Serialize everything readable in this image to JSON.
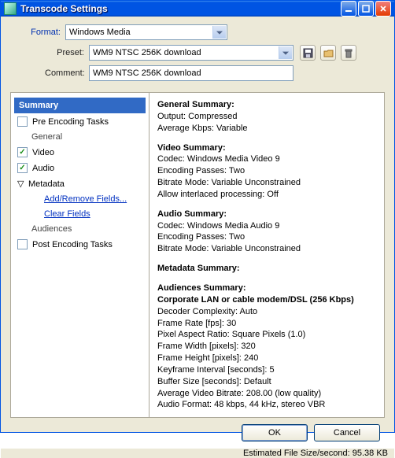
{
  "title": "Transcode Settings",
  "form": {
    "format_label": "Format:",
    "format_value": "Windows Media",
    "preset_label": "Preset:",
    "preset_value": "WM9 NTSC 256K download",
    "comment_label": "Comment:",
    "comment_value": "WM9 NTSC 256K download"
  },
  "tree": {
    "summary": "Summary",
    "pre": "Pre Encoding Tasks",
    "general": "General",
    "video": "Video",
    "audio": "Audio",
    "metadata": "Metadata",
    "add_remove": "Add/Remove Fields...",
    "clear": "Clear Fields",
    "audiences": "Audiences",
    "post": "Post Encoding Tasks"
  },
  "details": {
    "general_title": "General Summary:",
    "output": "Output: Compressed",
    "avg_kbps": "Average Kbps: Variable",
    "video_title": "Video Summary:",
    "v_codec": "Codec: Windows Media Video 9",
    "v_passes": "Encoding Passes: Two",
    "v_bitrate": "Bitrate Mode: Variable Unconstrained",
    "v_interlaced": "Allow interlaced processing: Off",
    "audio_title": "Audio Summary:",
    "a_codec": "Codec: Windows Media Audio 9",
    "a_passes": "Encoding Passes: Two",
    "a_bitrate": "Bitrate Mode: Variable Unconstrained",
    "meta_title": "Metadata Summary:",
    "aud_title": "Audiences Summary:",
    "aud_name": "Corporate LAN or cable modem/DSL (256 Kbps)",
    "decoder": "Decoder Complexity: Auto",
    "fps": "Frame Rate [fps]: 30",
    "par": "Pixel Aspect Ratio: Square Pixels (1.0)",
    "fw": "Frame Width [pixels]: 320",
    "fh": "Frame Height [pixels]: 240",
    "kf": "Keyframe Interval [seconds]: 5",
    "buf": "Buffer Size [seconds]: Default",
    "avb": "Average Video Bitrate: 208.00 (low quality)",
    "af": "Audio Format:  48 kbps, 44 kHz, stereo VBR"
  },
  "buttons": {
    "ok": "OK",
    "cancel": "Cancel"
  },
  "status": "Estimated File Size/second: 95.38 KB"
}
